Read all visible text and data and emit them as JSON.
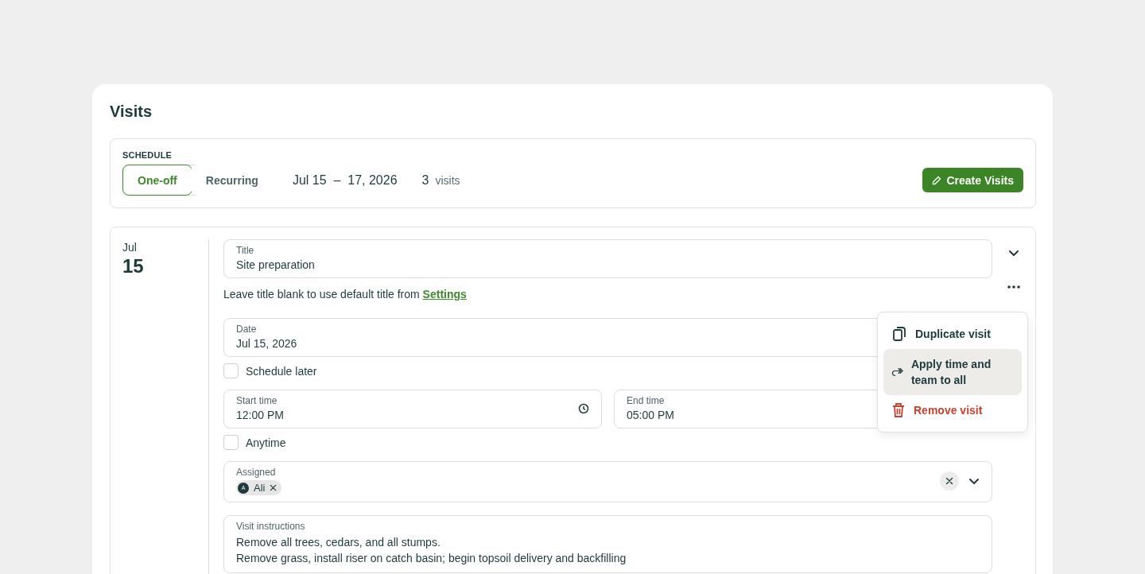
{
  "page": {
    "title": "Visits"
  },
  "schedule": {
    "label": "SCHEDULE",
    "modes": [
      {
        "label": "One-off",
        "selected": true
      },
      {
        "label": "Recurring",
        "selected": false
      }
    ],
    "date_range": "Jul 15  –  17, 2026",
    "visit_count": "3",
    "visit_unit": "visits",
    "create_button": "Create Visits"
  },
  "visit": {
    "month": "Jul",
    "day": "15",
    "title_field": {
      "label": "Title",
      "value": "Site preparation"
    },
    "hint": "Leave title blank to use default title from",
    "hint_link": "Settings",
    "date_field": {
      "label": "Date",
      "value": "Jul 15, 2026"
    },
    "schedule_later": {
      "label": "Schedule later",
      "checked": false
    },
    "start_time": {
      "label": "Start time",
      "value": "12:00 PM"
    },
    "end_time": {
      "label": "End time",
      "value": "05:00 PM"
    },
    "anytime": {
      "label": "Anytime",
      "checked": false
    },
    "assigned": {
      "label": "Assigned",
      "chips": [
        {
          "initial": "A",
          "name": "Ali"
        }
      ]
    },
    "instructions": {
      "label": "Visit instructions",
      "lines": [
        "Remove all trees, cedars, and all stumps.",
        "Remove grass, install riser on catch basin; begin topsoil delivery and backfilling"
      ]
    }
  },
  "menu": {
    "items": [
      {
        "kind": "default",
        "label": "Duplicate visit",
        "selected": false
      },
      {
        "kind": "default",
        "label": "Apply time and team to all",
        "selected": true
      },
      {
        "kind": "danger",
        "label": "Remove visit",
        "selected": false
      }
    ]
  }
}
